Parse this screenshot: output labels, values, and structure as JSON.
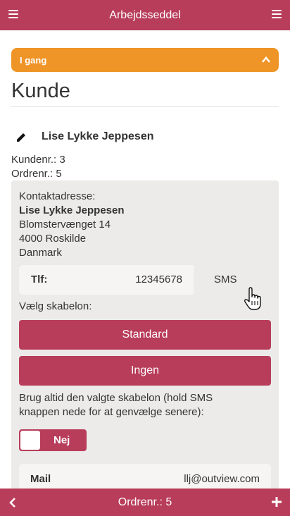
{
  "header": {
    "title": "Arbejdsseddel",
    "left_icon": "menu-icon",
    "right_icon": "menu-icon"
  },
  "status": {
    "label": "I gang",
    "icon": "chevron-up-icon",
    "color": "#ef9426"
  },
  "section": {
    "title": "Kunde"
  },
  "customer": {
    "name": "Lise Lykke Jeppesen",
    "kundenr": "Kundenr.: 3",
    "ordrenr": "Ordrenr.: 5"
  },
  "contact": {
    "heading": "Kontaktadresse:",
    "name": "Lise Lykke Jeppesen",
    "street": "Blomstervænget 14",
    "city": "4000 Roskilde",
    "country": "Danmark"
  },
  "phone": {
    "label": "Tlf:",
    "value": "12345678",
    "sms_label": "SMS"
  },
  "template": {
    "label": "Vælg skabelon:",
    "standard_button": "Standard",
    "none_button": "Ingen"
  },
  "always_use": {
    "text": "Brug altid den valgte skabelon (hold SMS knappen nede for at genvælge senere):",
    "toggle_label": "Nej"
  },
  "mail": {
    "label": "Mail",
    "value": "llj@outview.com"
  },
  "footer": {
    "title": "Ordrenr.: 5",
    "left_icon": "chevron-left-icon",
    "right_icon": "plus-icon"
  },
  "colors": {
    "brand": "#b83d5a",
    "status": "#ef9426",
    "panel": "#ecebea"
  }
}
